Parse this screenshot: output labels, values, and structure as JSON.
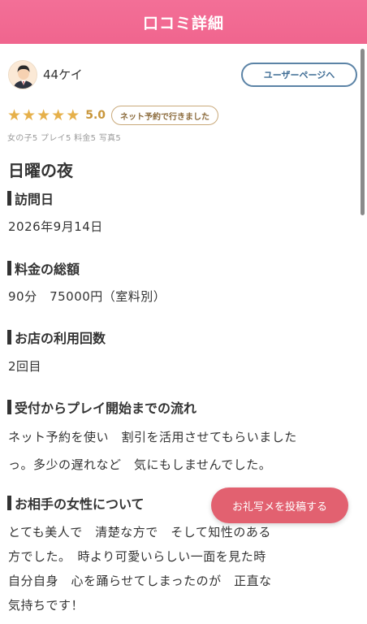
{
  "header": {
    "title": "口コミ詳細"
  },
  "user": {
    "name": "44ケイ",
    "user_page_button": "ユーザーページへ"
  },
  "rating": {
    "stars": 5,
    "score": "5.0",
    "visit_badge": "ネット予約で行きました"
  },
  "sub_scores": "女の子5 プレイ5 料金5 写真5",
  "review_title": "日曜の夜",
  "sections": [
    {
      "heading": "訪問日",
      "text": [
        "2026年9月14日"
      ]
    },
    {
      "heading": "料金の総額",
      "text": [
        "90分　75000円（室料別）"
      ]
    },
    {
      "heading": "お店の利用回数",
      "text": [
        "2回目"
      ]
    },
    {
      "heading": "受付からプレイ開始までの流れ",
      "text": [
        "ネット予約を使い　割引を活用させてもらいました",
        "っ。多少の遅れなど　気にもしませんでした。"
      ]
    },
    {
      "heading": "お相手の女性について",
      "text": [
        "とても美人で　清楚な方で　そして知性のある",
        "方でした。　時より可愛いらしい一面を見た時",
        "自分自身　心を踊らせてしまったのが　正直な",
        "気持ちです！"
      ]
    }
  ],
  "floating_button": "お礼写メを投稿する",
  "colors": {
    "header": "#f36f97",
    "star": "#e6b04a",
    "floating_button": "#e26170",
    "user_page_border": "#5b83a6"
  }
}
